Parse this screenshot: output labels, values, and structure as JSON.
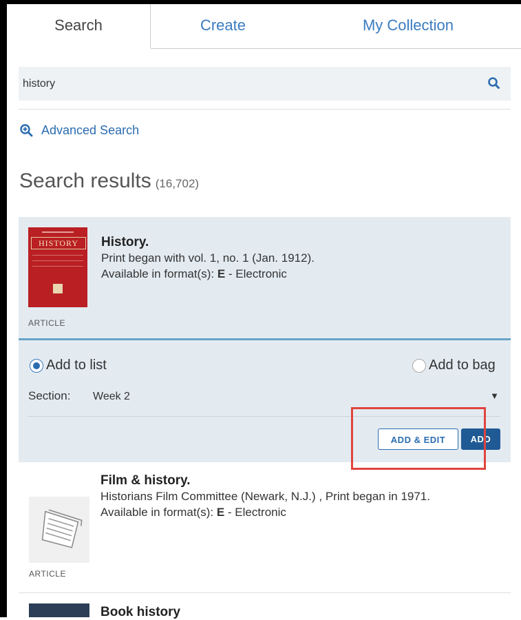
{
  "tabs": [
    {
      "label": "Search",
      "active": true
    },
    {
      "label": "Create",
      "active": false
    },
    {
      "label": "My Collection",
      "active": false
    }
  ],
  "search": {
    "value": "history",
    "icon": "search-icon"
  },
  "advanced_search": {
    "label": "Advanced Search",
    "icon": "zoom-in-icon"
  },
  "results": {
    "heading": "Search results",
    "count": "(16,702)"
  },
  "items": [
    {
      "title": "History.",
      "lines": [
        "Print began with vol. 1, no. 1 (Jan. 1912)."
      ],
      "format_prefix": "Available in format(s): ",
      "format_code": "E",
      "format_suffix": " - Electronic",
      "type": "ARTICLE",
      "thumb_text": "HISTORY"
    },
    {
      "title": "Film & history.",
      "lines": [
        "Historians Film Committee (Newark, N.J.) , Print began in 1971."
      ],
      "format_prefix": "Available in format(s): ",
      "format_code": "E",
      "format_suffix": " - Electronic",
      "type": "ARTICLE"
    },
    {
      "title": "Book history"
    }
  ],
  "add_panel": {
    "add_to_list": "Add to list",
    "add_to_bag": "Add to bag",
    "selected": "add_to_list",
    "section_label": "Section:",
    "section_value": "Week 2",
    "add_edit_label": "ADD & EDIT",
    "add_label": "ADD"
  },
  "colors": {
    "accent": "#2b6cb0",
    "selected_bg": "#e3ebf1",
    "highlight": "#e0443e"
  }
}
